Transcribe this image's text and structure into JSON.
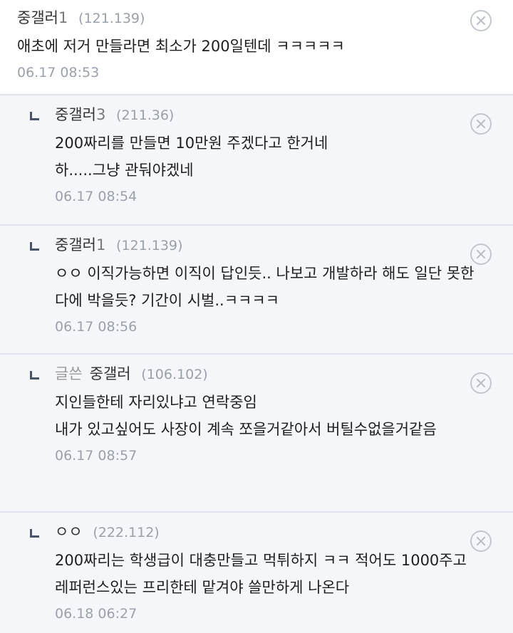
{
  "comments": [
    {
      "nick": "중갤러",
      "nick_suffix": "1",
      "ip": "(121.139)",
      "lines": [
        "애초에 저거 만들라면 최소가 200일텐데 ㅋㅋㅋㅋㅋ"
      ],
      "date": "06.17 08:53"
    },
    {
      "nick": "중갤러",
      "nick_suffix": "3",
      "ip": "(211.36)",
      "lines": [
        "200짜리를 만들면 10만원 주겠다고 한거네",
        "하.....그냥 관둬야겠네"
      ],
      "date": "06.17 08:54"
    },
    {
      "nick": "중갤러",
      "nick_suffix": "1",
      "ip": "(121.139)",
      "lines": [
        "ㅇㅇ 이직가능하면 이직이 답인듯.. 나보고 개발하라 해도 일단 못한다에 박을듯? 기간이 시벌..ㅋㅋㅋㅋ"
      ],
      "date": "06.17 08:56"
    },
    {
      "writer_tag": "글쓴",
      "nick": "중갤러",
      "ip": "(106.102)",
      "lines": [
        "지인들한테 자리있냐고 연락중임",
        "내가 있고싶어도 사장이 계속 쪼을거같아서 버틸수없을거같음"
      ],
      "date": "06.17 08:57"
    },
    {
      "nick": "ㅇㅇ",
      "ip": "(222.112)",
      "lines": [
        "200짜리는 학생급이 대충만들고 먹튀하지 ㅋㅋ 적어도 1000주고 레퍼런스있는 프리한테 맡겨야 쓸만하게 나온다"
      ],
      "date": "06.18 06:27"
    }
  ],
  "icons": {
    "delete": "circle-x-icon",
    "reply": "reply-arrow-icon"
  },
  "colors": {
    "reply_bg": "#f5f6f9",
    "divider": "#dfe2ea",
    "meta_text": "#9ba1aa"
  }
}
